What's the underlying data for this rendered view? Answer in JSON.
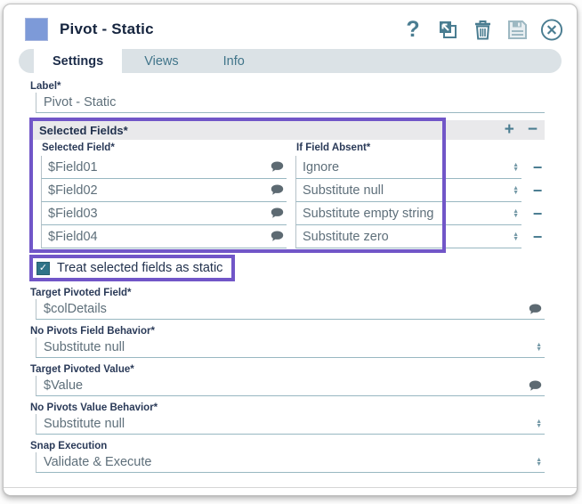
{
  "header": {
    "title": "Pivot - Static",
    "icon_names": [
      "help-icon",
      "open-icon",
      "trash-icon",
      "save-icon",
      "close-icon"
    ]
  },
  "tabs": [
    {
      "label": "Settings",
      "active": true
    },
    {
      "label": "Views",
      "active": false
    },
    {
      "label": "Info",
      "active": false
    }
  ],
  "fields": {
    "label": {
      "label": "Label*",
      "value": "Pivot - Static"
    },
    "selected_fields": {
      "section_title": "Selected Fields*",
      "columns": [
        "Selected Field*",
        "If Field Absent*"
      ],
      "rows": [
        {
          "field": "$Field01",
          "absent": "Ignore"
        },
        {
          "field": "$Field02",
          "absent": "Substitute null"
        },
        {
          "field": "$Field03",
          "absent": "Substitute empty string"
        },
        {
          "field": "$Field04",
          "absent": "Substitute zero"
        }
      ]
    },
    "static_checkbox": {
      "label": "Treat selected fields as static",
      "checked": true
    },
    "target_pivoted_field": {
      "label": "Target Pivoted Field*",
      "value": "$colDetails"
    },
    "no_pivots_field_behavior": {
      "label": "No Pivots Field Behavior*",
      "value": "Substitute null"
    },
    "target_pivoted_value": {
      "label": "Target Pivoted Value*",
      "value": "$Value"
    },
    "no_pivots_value_behavior": {
      "label": "No Pivots Value Behavior*",
      "value": "Substitute null"
    },
    "snap_execution": {
      "label": "Snap Execution",
      "value": "Validate & Execute"
    }
  },
  "icons": {
    "help_glyph": "?",
    "plus_glyph": "+",
    "minus_glyph": "−",
    "spinner_up": "▲",
    "spinner_down": "▼",
    "check_glyph": "✓"
  },
  "colors": {
    "accent_teal": "#4a7d91",
    "highlight_purple": "#7156c8",
    "snap_icon_blue": "#7d9ad8",
    "checkbox_teal": "#2f7388",
    "title_navy": "#16253f"
  }
}
